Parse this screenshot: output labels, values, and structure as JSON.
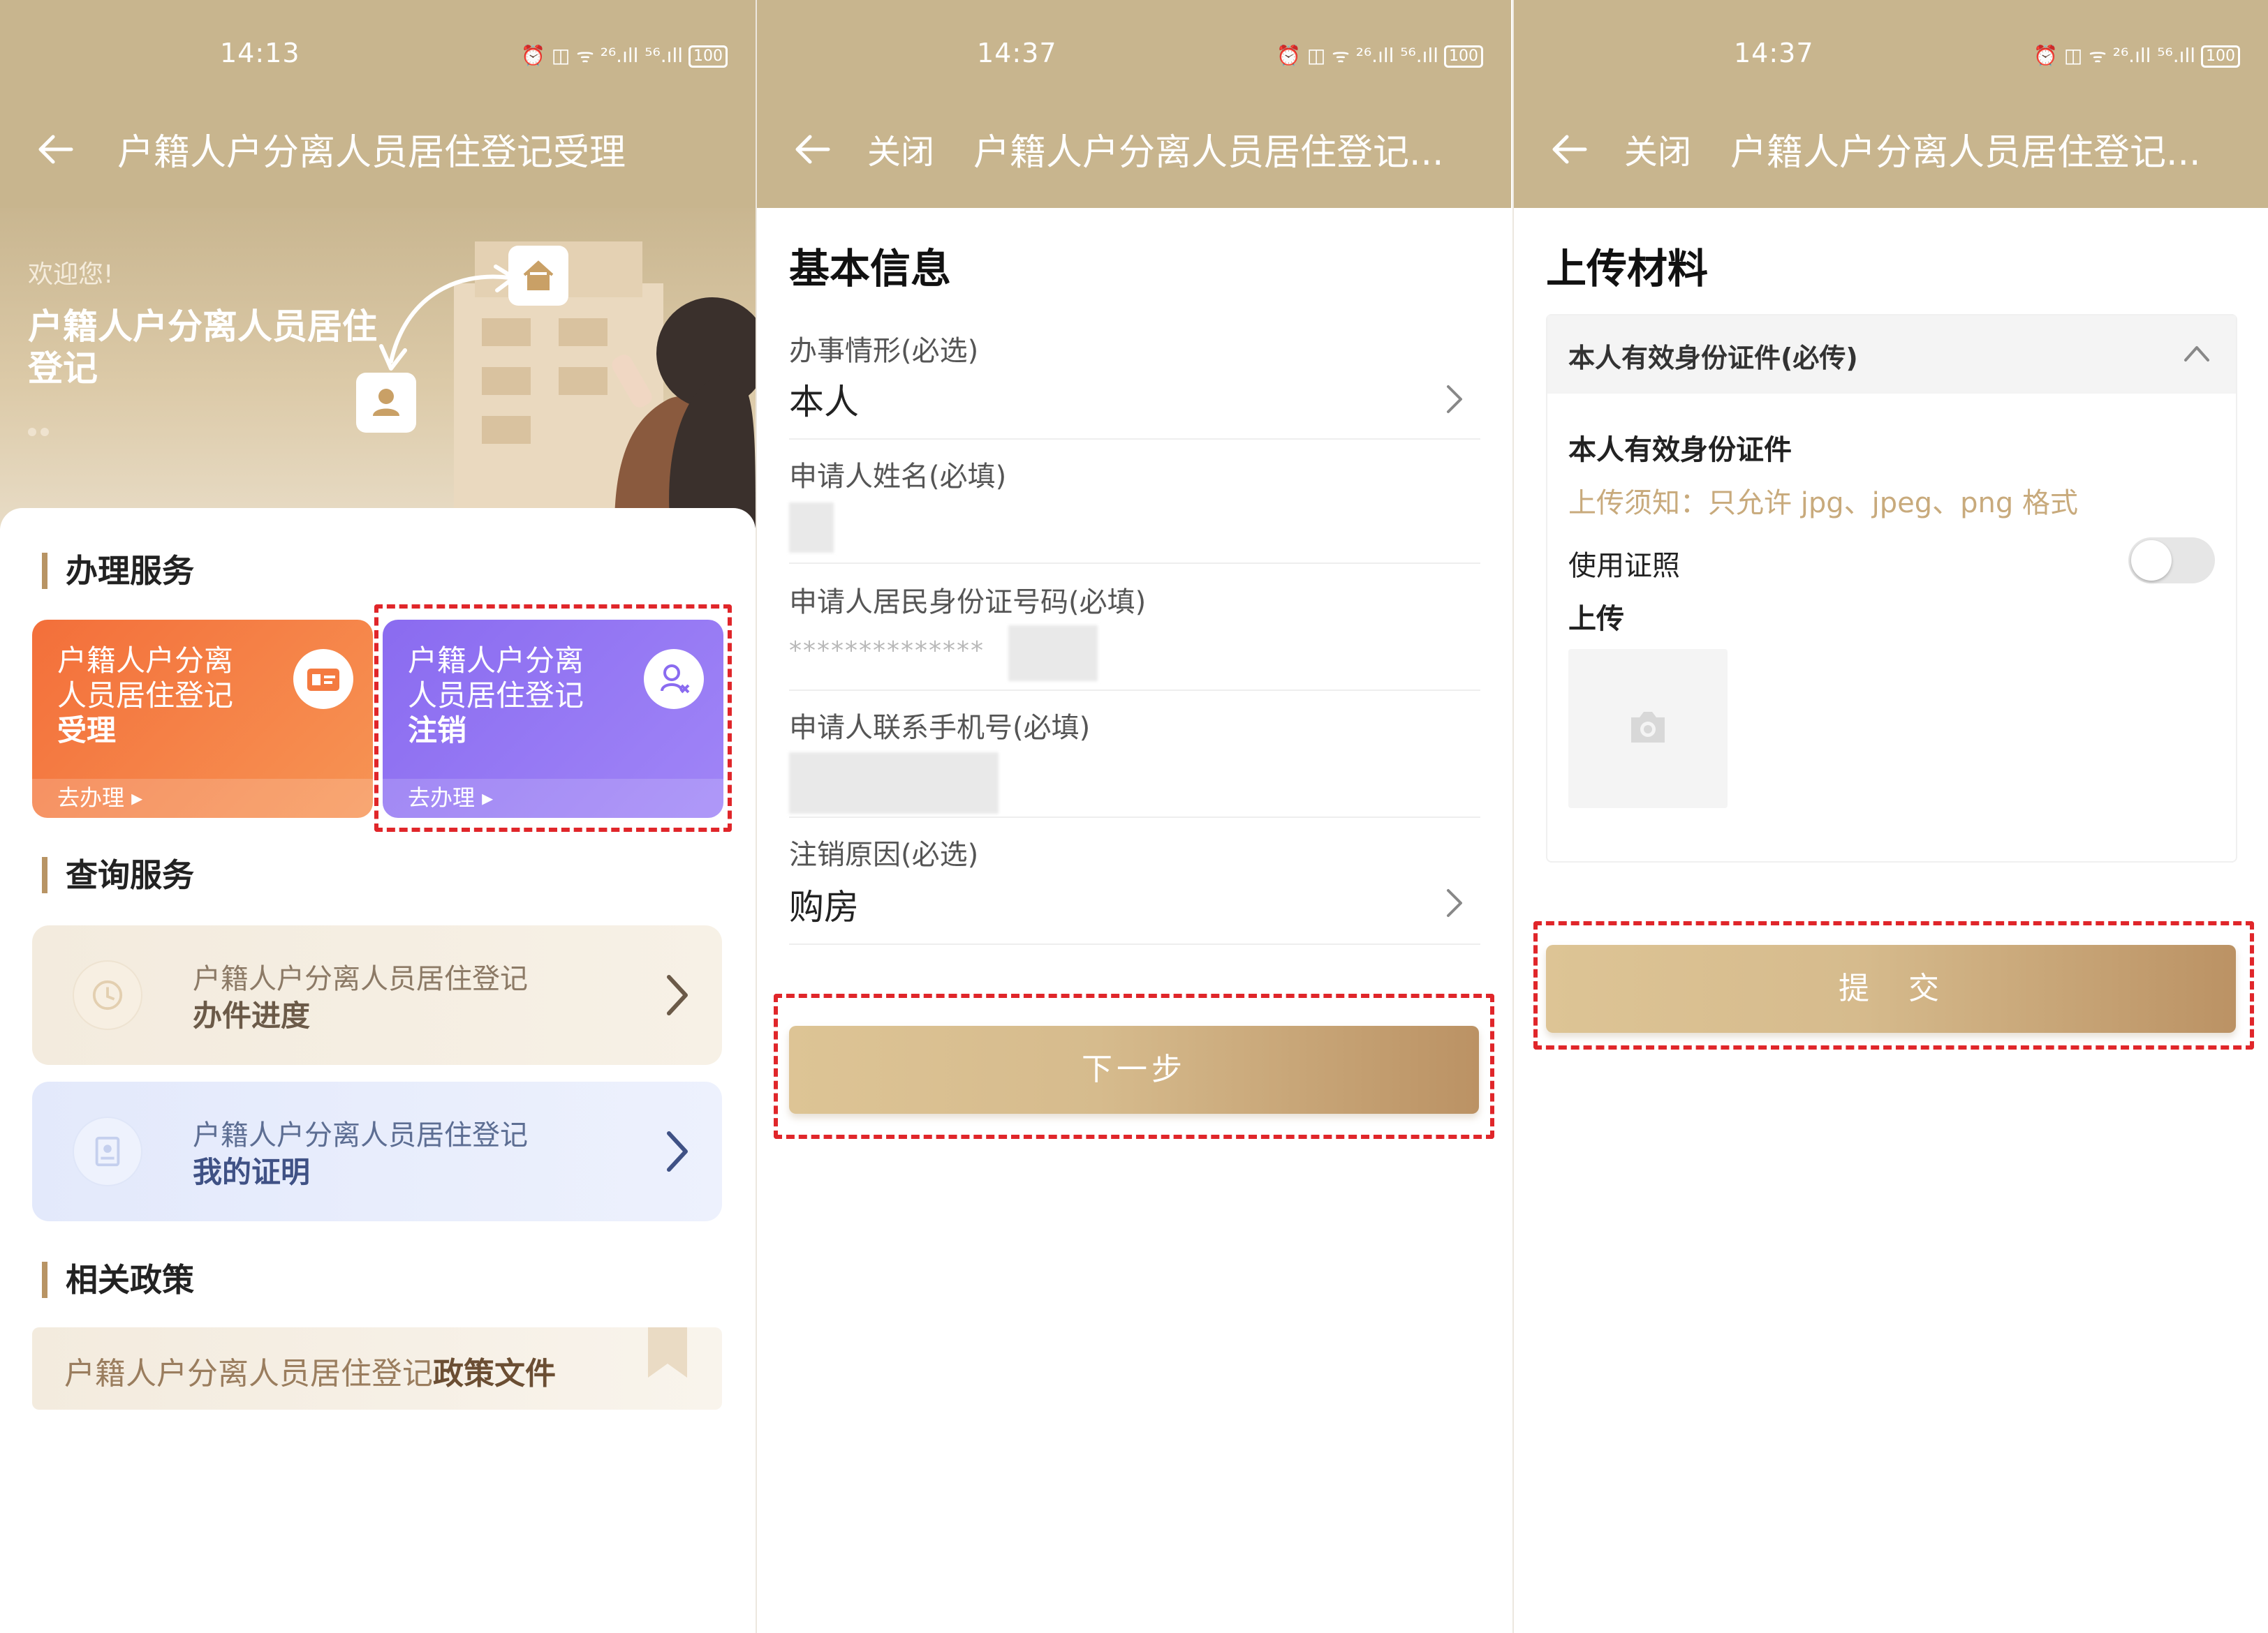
{
  "screens": [
    {
      "status_time": "14:13",
      "status_battery": "100",
      "status_signal": "⏰ ◫ ᯤ ²⁶.ıll ⁵⁶.ıll",
      "title": "户籍人户分离人员居住登记受理",
      "banner": {
        "welcome": "欢迎您!",
        "title": "户籍人户分离人员居住登记"
      },
      "handle_section": {
        "heading": "办理服务",
        "cards": [
          {
            "line1": "户籍人户分离",
            "line2": "人员居住登记",
            "line3": "受理",
            "go": "去办理 ▸",
            "icon": "id-card-icon"
          },
          {
            "line1": "户籍人户分离",
            "line2": "人员居住登记",
            "line3": "注销",
            "go": "去办理 ▸",
            "icon": "person-remove-icon"
          }
        ]
      },
      "query_section": {
        "heading": "查询服务",
        "items": [
          {
            "line1": "户籍人户分离人员居住登记",
            "line2": "办件进度",
            "icon": "clock-icon"
          },
          {
            "line1": "户籍人户分离人员居住登记",
            "line2": "我的证明",
            "icon": "certificate-icon"
          }
        ]
      },
      "policy_section": {
        "heading": "相关政策",
        "text": "户籍人户分离人员居住登记",
        "text_strong": "政策文件"
      }
    },
    {
      "status_time": "14:37",
      "status_battery": "100",
      "status_signal": "⏰ ◫ ᯤ ²⁶.ıll ⁵⁶.ıll",
      "close": "关闭",
      "title": "户籍人户分离人员居住登记...",
      "page_title": "基本信息",
      "fields": [
        {
          "label": "办事情形(必选)",
          "value": "本人"
        },
        {
          "label": "申请人姓名(必填)",
          "value": ""
        },
        {
          "label": "申请人居民身份证号码(必填)",
          "value": "**************"
        },
        {
          "label": "申请人联系手机号(必填)",
          "value": ""
        },
        {
          "label": "注销原因(必选)",
          "value": "购房"
        }
      ],
      "next_button": "下一步"
    },
    {
      "status_time": "14:37",
      "status_battery": "100",
      "status_signal": "⏰ ◫ ᯤ ²⁶.ıll ⁵⁶.ıll",
      "close": "关闭",
      "title": "户籍人户分离人员居住登记...",
      "page_title": "上传材料",
      "panel_header": "本人有效身份证件(必传)",
      "doc_title": "本人有效身份证件",
      "upload_note": "上传须知：只允许 jpg、jpeg、png 格式",
      "use_license": "使用证照",
      "use_license_enabled": false,
      "upload_label": "上传",
      "submit_button": "提　交"
    }
  ],
  "colors": {
    "header": "#c8b58e",
    "accent": "#b89464",
    "orange_card": "#f36f3a",
    "purple_card": "#8a6bf0",
    "highlight_dash": "#e0262a"
  }
}
